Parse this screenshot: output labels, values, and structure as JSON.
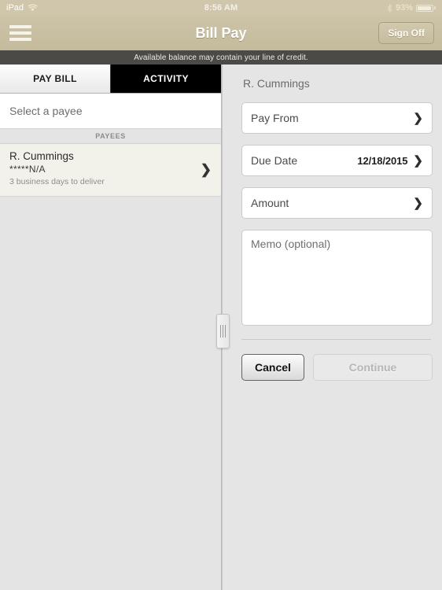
{
  "status_bar": {
    "device": "iPad",
    "wifi_icon": "wifi-icon",
    "time": "8:56 AM",
    "bluetooth_icon": "bluetooth-icon",
    "battery_percent": "93%",
    "battery_level": 93
  },
  "nav_bar": {
    "menu_icon": "hamburger-menu-icon",
    "title": "Bill Pay",
    "sign_off_label": "Sign Off"
  },
  "notice": {
    "text": "Available balance may contain your line of credit."
  },
  "master": {
    "tabs": [
      {
        "label": "PAY BILL",
        "selected": true
      },
      {
        "label": "ACTIVITY",
        "selected": false
      }
    ],
    "select_payee_label": "Select a payee",
    "section_header": "PAYEES",
    "payees": [
      {
        "name": "R. Cummings",
        "account": "*****N/A",
        "delivery": "3 business days to deliver",
        "chevron": "chevron-right-icon"
      }
    ]
  },
  "divider": {
    "handle_icon": "split-view-drag-handle"
  },
  "detail": {
    "title": "R. Cummings",
    "fields": [
      {
        "label": "Pay From",
        "value": "",
        "chevron": "chevron-right-icon"
      },
      {
        "label": "Due Date",
        "value": "12/18/2015",
        "chevron": "chevron-right-icon"
      },
      {
        "label": "Amount",
        "value": "",
        "chevron": "chevron-right-icon"
      }
    ],
    "memo_placeholder": "Memo (optional)",
    "memo_value": "",
    "cancel_label": "Cancel",
    "continue_label": "Continue",
    "continue_enabled": false
  },
  "colors": {
    "nav_bar": "#c7bda0",
    "notice_bar": "#4c4a47",
    "tab_selected_bg": "#f4f4f4",
    "tab_unselected_bg": "#000000",
    "panel_bg": "#e5e5e5",
    "payee_selected_bg": "#f2f1ea"
  }
}
